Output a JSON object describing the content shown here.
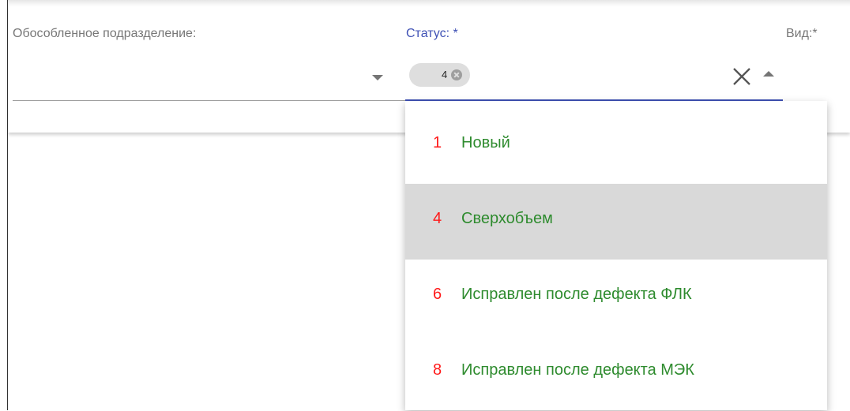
{
  "filters": {
    "division_label": "Обособленное подразделение:",
    "status_label": "Статус: *",
    "vid_label": "Вид:*",
    "status_chip": "4"
  },
  "dropdown": {
    "options": [
      {
        "code": "1",
        "name": "Новый",
        "selected": false
      },
      {
        "code": "4",
        "name": "Сверхобъем",
        "selected": true
      },
      {
        "code": "6",
        "name": "Исправлен после дефекта ФЛК",
        "selected": false
      },
      {
        "code": "8",
        "name": "Исправлен после дефекта МЭК",
        "selected": false
      }
    ]
  },
  "colors": {
    "accent": "#3f51b5",
    "code": "#ff1a1a",
    "name": "#2e8b2e",
    "selected_bg": "#d9d9d9"
  },
  "icons": {
    "chip_delete": "cancel-circle-icon",
    "clear": "close-icon",
    "collapse": "arrow-up-icon",
    "expand": "arrow-down-icon"
  }
}
